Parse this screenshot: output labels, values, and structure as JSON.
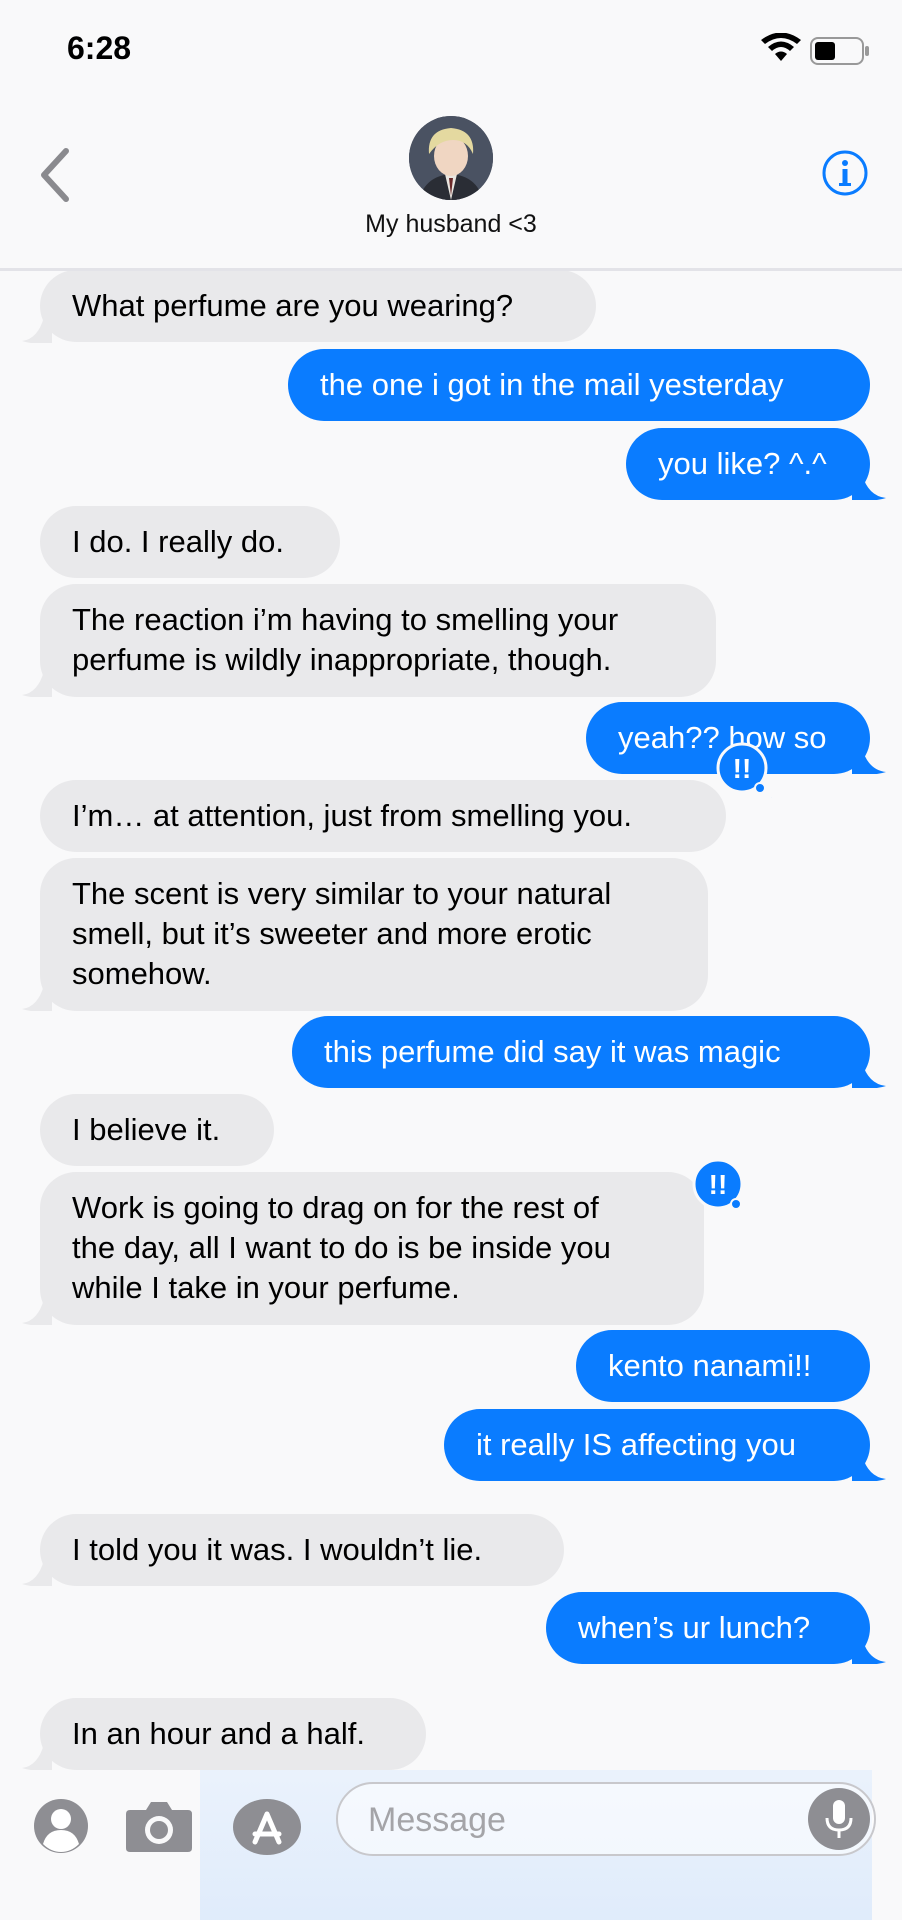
{
  "status": {
    "time": "6:28"
  },
  "header": {
    "contact_name": "My husband <3"
  },
  "messages": [
    {
      "from": "in",
      "text": "What perfume are you wearing?"
    },
    {
      "from": "out",
      "text": "the one i got in the mail yesterday"
    },
    {
      "from": "out",
      "text": "you like? ^.^"
    },
    {
      "from": "in",
      "text": "I do. I really do."
    },
    {
      "from": "in",
      "text": "The reaction i’m having to smelling your\nperfume is wildly inappropriate, though."
    },
    {
      "from": "out",
      "text": "yeah?? how so",
      "reaction": "!!"
    },
    {
      "from": "in",
      "text": "I’m… at attention, just from smelling you."
    },
    {
      "from": "in",
      "text": "The scent is very similar to your natural\nsmell, but it’s sweeter and more erotic\nsomehow."
    },
    {
      "from": "out",
      "text": "this perfume did say it was magic"
    },
    {
      "from": "in",
      "text": "I believe it."
    },
    {
      "from": "in",
      "text": "Work is going to drag on for the rest of\nthe day, all I want to do is be inside you\nwhile I take in your perfume.",
      "reaction": "!!"
    },
    {
      "from": "out",
      "text": "kento nanami!!"
    },
    {
      "from": "out",
      "text": "it really IS affecting you"
    },
    {
      "from": "in",
      "text": "I told you it was. I wouldn’t lie."
    },
    {
      "from": "out",
      "text": "when’s ur lunch?"
    },
    {
      "from": "in",
      "text": "In an hour and a half."
    }
  ],
  "input": {
    "placeholder": "Message"
  },
  "colors": {
    "outgoing": "#0a7cff",
    "incoming": "#e9e9eb",
    "accent": "#0a7cff"
  },
  "icons": [
    "back-chevron-icon",
    "info-icon",
    "contact-icon",
    "camera-icon",
    "app-store-icon",
    "mic-icon"
  ]
}
